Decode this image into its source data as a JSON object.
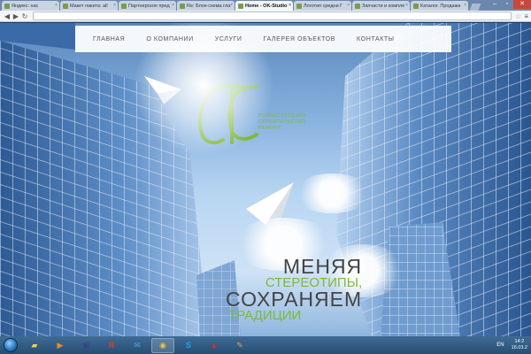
{
  "browser": {
    "tabs": [
      {
        "label": "Яндекс: нас"
      },
      {
        "label": "Макет пакета: all"
      },
      {
        "label": "Партнерское пред"
      },
      {
        "label": "Re: Блок-схема гла"
      },
      {
        "label": "Home - OK-Studio"
      },
      {
        "label": "Логотип средни Г"
      },
      {
        "label": "Запчасти и компле"
      },
      {
        "label": "Каталог. Продажа"
      }
    ],
    "active_tab_index": 4,
    "address": ""
  },
  "site": {
    "nav": [
      {
        "label": "ГЛАВНАЯ"
      },
      {
        "label": "О КОМПАНИИ"
      },
      {
        "label": "УСЛУГИ"
      },
      {
        "label": "ГАЛЕРЕЯ ОБЪЕКТОВ"
      },
      {
        "label": "КОНТАКТЫ"
      }
    ],
    "logo_lines": [
      "РЕКОНСТРУКЦИЯ",
      "СТРОИТЕЛЬСТВО",
      "РЕМОНТ"
    ],
    "slogan": {
      "line1": "МЕНЯЯ",
      "line2": "СТЕРЕОТИПЫ,",
      "line3": "СОХРАНЯЕМ",
      "line4": "ТРАДИЦИИ"
    },
    "colors": {
      "accent_green": "#7fb83a",
      "text_dark": "#444444"
    }
  },
  "taskbar": {
    "items": [
      {
        "icon": "folder-icon"
      },
      {
        "icon": "media-player-icon"
      },
      {
        "icon": "floppy-save-icon"
      },
      {
        "icon": "yandex-icon"
      },
      {
        "icon": "mail-icon"
      },
      {
        "icon": "chrome-icon"
      },
      {
        "icon": "skype-icon"
      },
      {
        "icon": "acrobat-icon"
      },
      {
        "icon": "paint-icon"
      }
    ],
    "language": "EN",
    "time": "14:2",
    "date": "16.03.2"
  }
}
